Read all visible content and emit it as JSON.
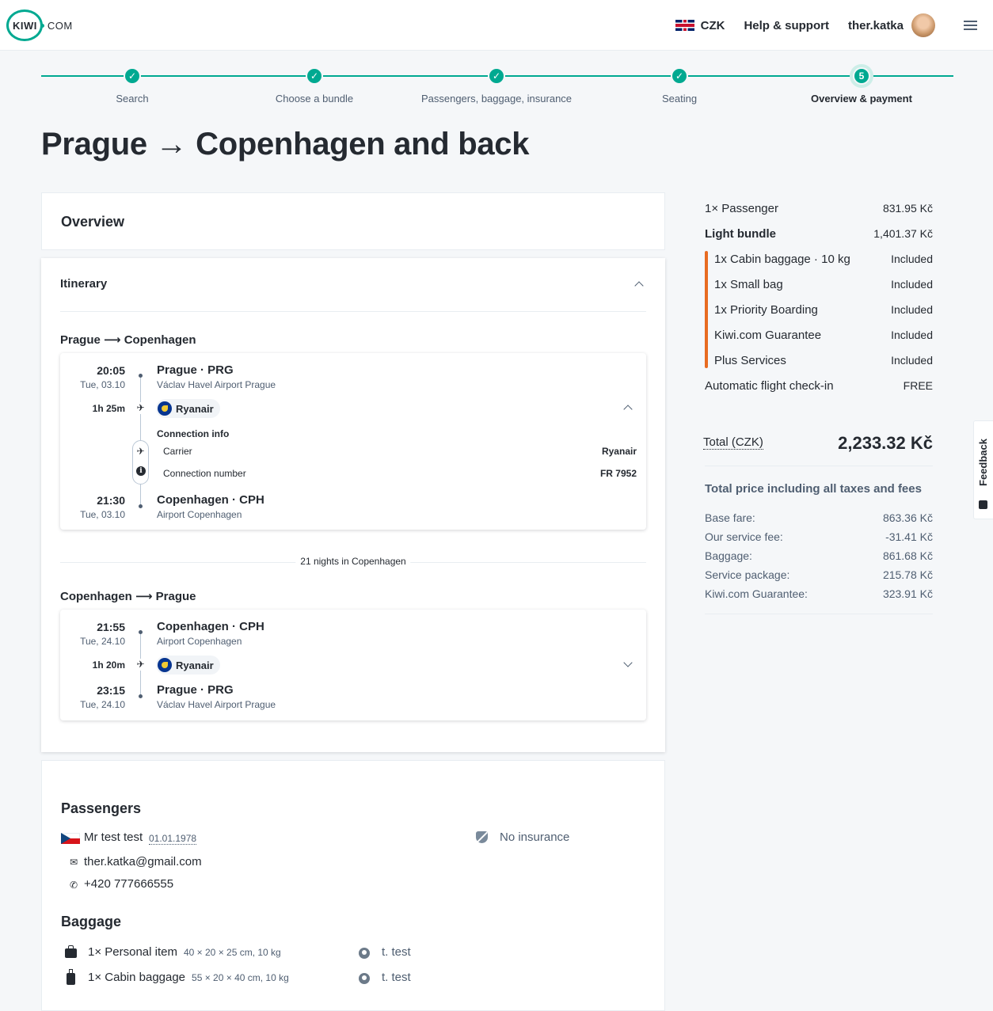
{
  "header": {
    "logo_left": "KIWI",
    "logo_right": "COM",
    "currency": "CZK",
    "help": "Help & support",
    "username": "ther.katka"
  },
  "progress": {
    "steps": [
      {
        "label": "Search",
        "marker": "✓"
      },
      {
        "label": "Choose a bundle",
        "marker": "✓"
      },
      {
        "label": "Passengers, baggage, insurance",
        "marker": "✓"
      },
      {
        "label": "Seating",
        "marker": "✓"
      },
      {
        "label": "Overview & payment",
        "marker": "5"
      }
    ],
    "current_step": 5
  },
  "page_title": "Prague → Copenhagen and back",
  "overview": {
    "title": "Overview"
  },
  "itinerary": {
    "title": "Itinerary",
    "outbound": {
      "title": "Prague ⟶ Copenhagen",
      "dep_time": "20:05",
      "dep_date": "Tue, 03.10",
      "dep_place": "Prague · PRG",
      "dep_airport": "Václav Havel Airport Prague",
      "duration": "1h 25m",
      "carrier": "Ryanair",
      "connection_title": "Connection info",
      "carrier_label": "Carrier",
      "carrier_value": "Ryanair",
      "conn_number_label": "Connection number",
      "conn_number_value": "FR 7952",
      "arr_time": "21:30",
      "arr_date": "Tue, 03.10",
      "arr_place": "Copenhagen · CPH",
      "arr_airport": "Airport Copenhagen"
    },
    "nights": "21 nights in Copenhagen",
    "inbound": {
      "title": "Copenhagen ⟶ Prague",
      "dep_time": "21:55",
      "dep_date": "Tue, 24.10",
      "dep_place": "Copenhagen · CPH",
      "dep_airport": "Airport Copenhagen",
      "duration": "1h 20m",
      "carrier": "Ryanair",
      "arr_time": "23:15",
      "arr_date": "Tue, 24.10",
      "arr_place": "Prague · PRG",
      "arr_airport": "Václav Havel Airport Prague"
    }
  },
  "passengers": {
    "title": "Passengers",
    "name": "Mr test test",
    "dob": "01.01.1978",
    "email": "ther.katka@gmail.com",
    "phone": "+420 777666555",
    "insurance": "No insurance"
  },
  "baggage": {
    "title": "Baggage",
    "items": [
      {
        "name": "1× Personal item",
        "dims": "40 × 20 × 25 cm, 10 kg",
        "owner": "t. test",
        "icon": "personal-bag-icon"
      },
      {
        "name": "1× Cabin baggage",
        "dims": "55 × 20 × 40 cm, 10 kg",
        "owner": "t. test",
        "icon": "cabin-trolley-icon"
      }
    ]
  },
  "summary": {
    "rows": [
      {
        "label": "1× Passenger",
        "value": "831.95 Kč"
      },
      {
        "label": "Light bundle",
        "value": "1,401.37 Kč"
      },
      {
        "label": "1x Cabin baggage · 10 kg",
        "value": "Included"
      },
      {
        "label": "1x Small bag",
        "value": "Included"
      },
      {
        "label": "1x Priority Boarding",
        "value": "Included"
      },
      {
        "label": "Kiwi.com Guarantee",
        "value": "Included"
      },
      {
        "label": "Plus Services",
        "value": "Included"
      },
      {
        "label": "Automatic flight check-in",
        "value": "FREE"
      }
    ],
    "total_label": "Total (CZK)",
    "total_value": "2,233.32 Kč",
    "incl_title": "Total price including all taxes and fees",
    "fees": [
      {
        "label": "Base fare:",
        "value": "863.36 Kč"
      },
      {
        "label": "Our service fee:",
        "value": "-31.41 Kč"
      },
      {
        "label": "Baggage:",
        "value": "861.68 Kč"
      },
      {
        "label": "Service package:",
        "value": "215.78 Kč"
      },
      {
        "label": "Kiwi.com Guarantee:",
        "value": "323.91 Kč"
      }
    ]
  },
  "feedback": "Feedback",
  "colors": {
    "accent": "#00a991",
    "bundle_bar": "#e86b21",
    "text": "#252a31",
    "muted": "#4f5e71"
  }
}
